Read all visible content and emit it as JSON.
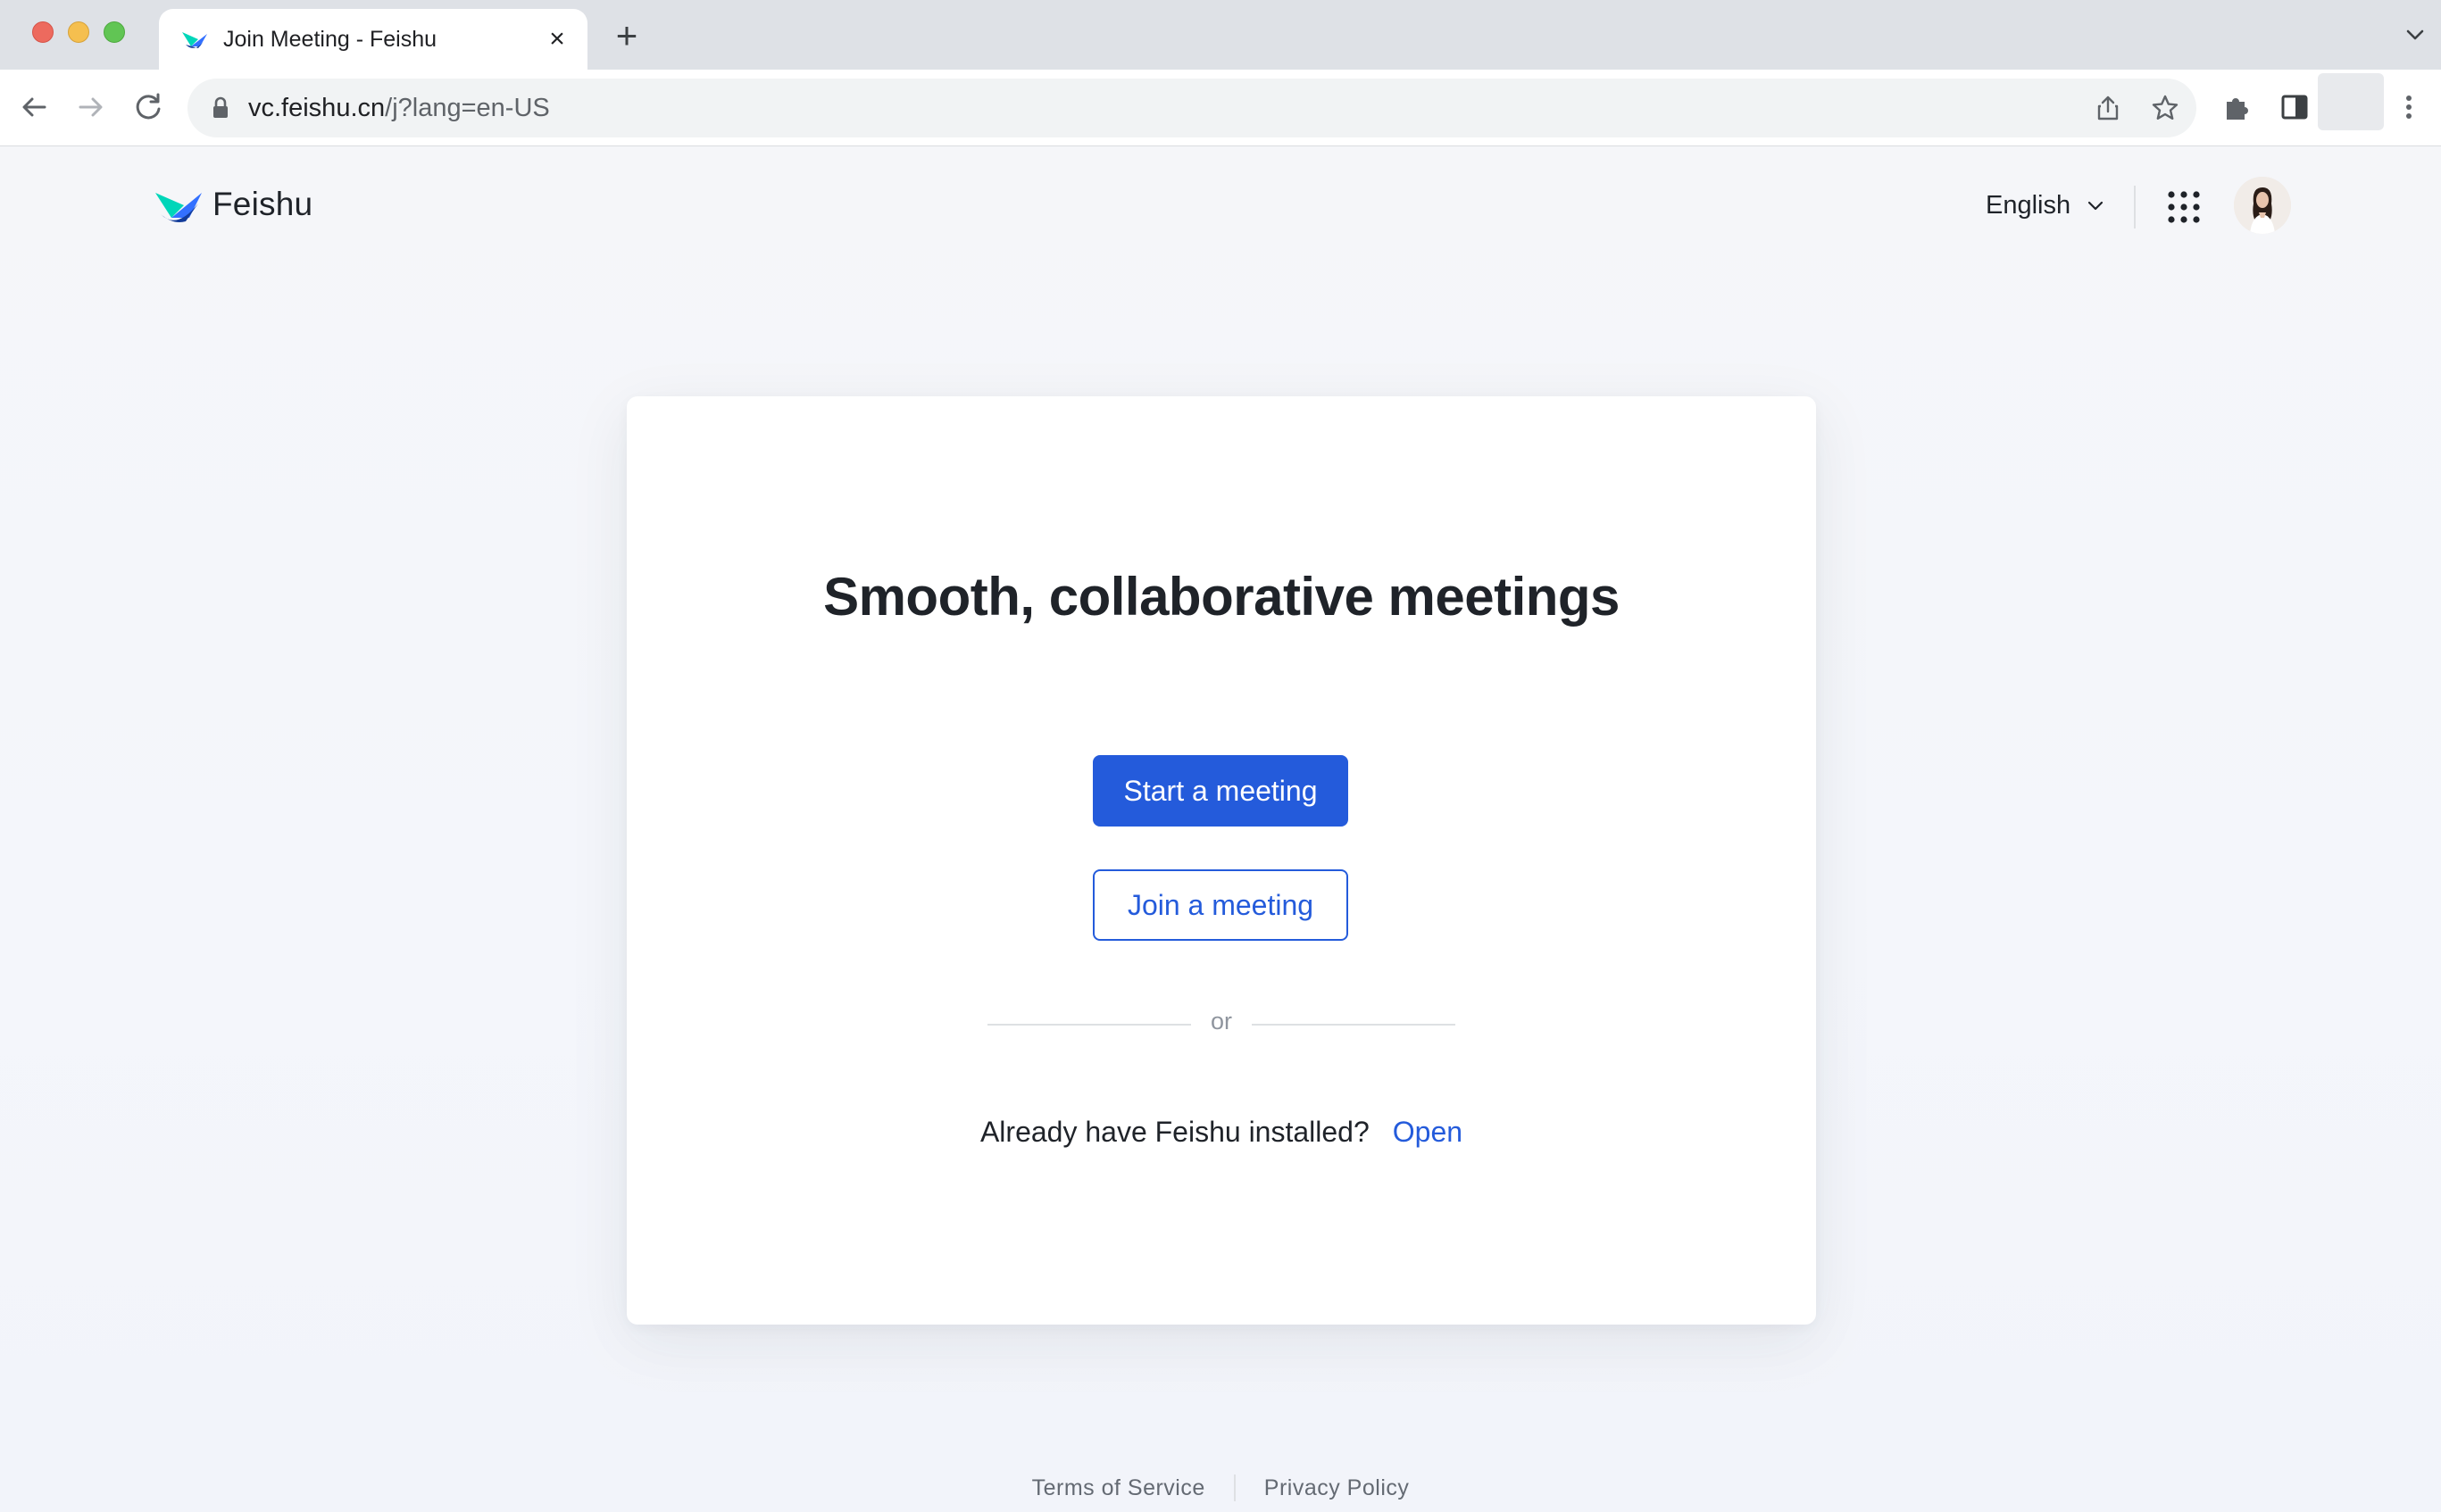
{
  "browser": {
    "tab_title": "Join Meeting - Feishu",
    "tab_close": "×",
    "new_tab": "+",
    "url_host": "vc.feishu.cn",
    "url_path": "/j?lang=en-US"
  },
  "header": {
    "brand": "Feishu",
    "language": "English"
  },
  "card": {
    "headline": "Smooth, collaborative meetings",
    "start_button": "Start a meeting",
    "join_button": "Join a meeting",
    "divider_text": "or",
    "installed_prompt": "Already have Feishu installed?",
    "open_link": "Open"
  },
  "footer": {
    "terms": "Terms of Service",
    "privacy": "Privacy Policy"
  },
  "colors": {
    "brand_blue": "#245bdb",
    "text_primary": "#1f2329",
    "page_background": "#f4f6fb"
  }
}
